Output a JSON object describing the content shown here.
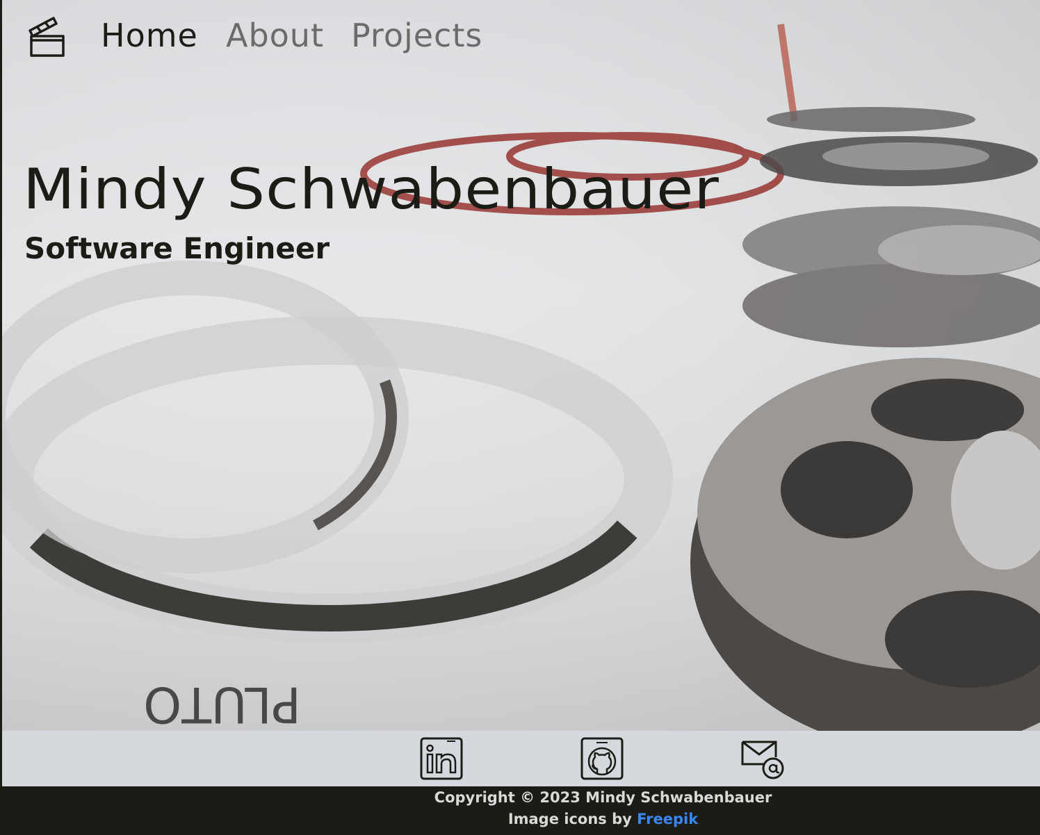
{
  "nav": {
    "logo_icon": "clapperboard-icon",
    "items": [
      {
        "label": "Home",
        "active": true
      },
      {
        "label": "About",
        "active": false
      },
      {
        "label": "Projects",
        "active": false
      }
    ]
  },
  "hero": {
    "name": "Mindy Schwabenbauer",
    "role": "Software Engineer",
    "background": "film-reels-photo"
  },
  "social": {
    "links": [
      {
        "icon": "linkedin-icon"
      },
      {
        "icon": "github-icon"
      },
      {
        "icon": "email-icon"
      }
    ]
  },
  "footer": {
    "copyright": "Copyright © 2023 Mindy Schwabenbauer",
    "credit_prefix": "Image icons by ",
    "credit_link": "Freepik"
  },
  "colors": {
    "text_dark": "#1c1c17",
    "nav_inactive": "#6b6b6b",
    "social_bar": "#d5d8dd",
    "footer_bg": "#1c1c17",
    "link": "#3b86f0"
  }
}
